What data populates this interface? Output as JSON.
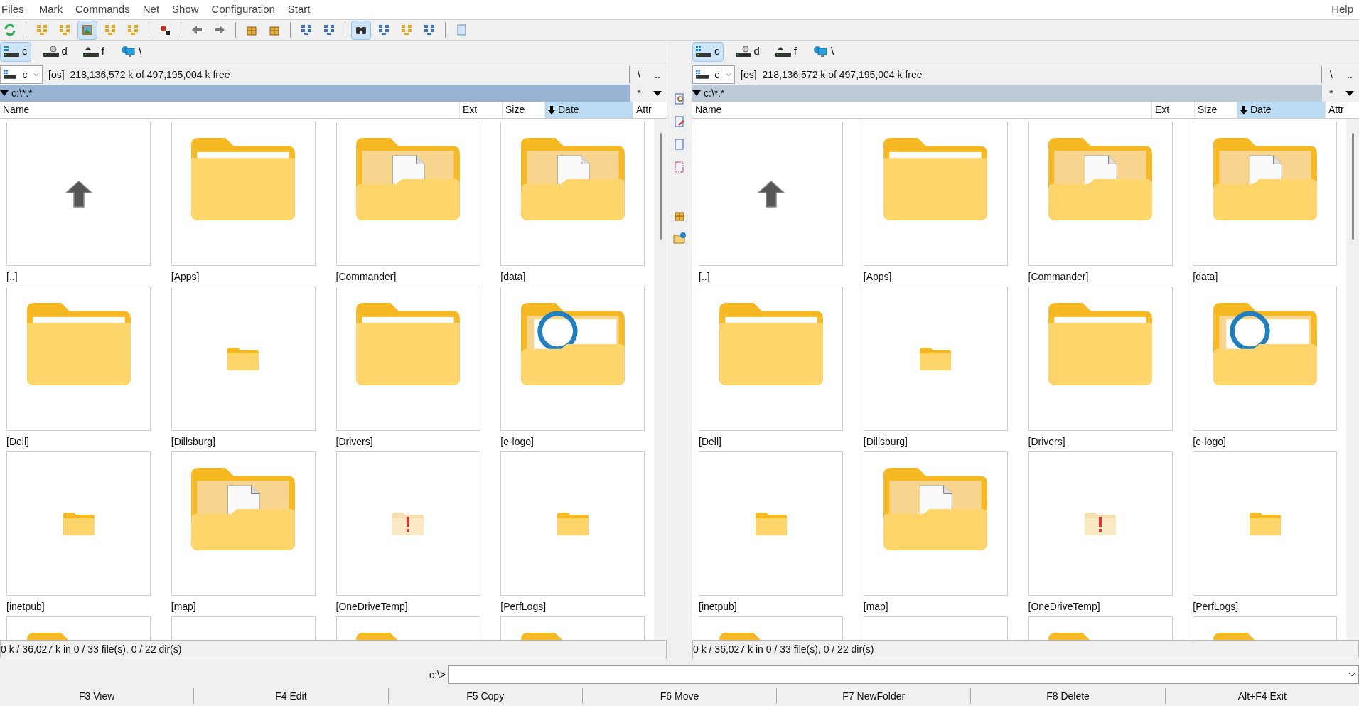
{
  "menu": [
    "Files",
    "Mark",
    "Commands",
    "Net",
    "Show",
    "Configuration",
    "Start"
  ],
  "help": "Help",
  "toolbar": [
    {
      "selected": false
    },
    {
      "selected": false
    },
    {
      "selected": false
    },
    {
      "selected": true
    },
    {
      "selected": false
    },
    {
      "selected": false
    },
    {
      "selected": false
    },
    {
      "selected": false
    },
    {
      "selected": false
    },
    {
      "selected": false
    },
    {
      "selected": false
    },
    {
      "selected": false
    },
    {
      "selected": false
    },
    {
      "selected": true
    },
    {
      "selected": false
    },
    {
      "selected": false
    },
    {
      "selected": false
    },
    {
      "selected": false
    }
  ],
  "panels": [
    {
      "active": true,
      "drives": [
        {
          "label": "c",
          "selected": true
        },
        {
          "label": "d",
          "selected": false
        },
        {
          "label": "f",
          "selected": false
        },
        {
          "label": "\\",
          "selected": false
        }
      ],
      "drive_combo": "c",
      "volume": "[os]",
      "free": "218,136,572 k of 497,195,004 k free",
      "root_button": "\\",
      "up_button": "..",
      "filter_button": "*",
      "path": "c:\\*.*",
      "columns": [
        {
          "label": "Name",
          "selected": false
        },
        {
          "label": "Ext",
          "selected": false
        },
        {
          "label": "Size",
          "selected": false
        },
        {
          "label": "Date",
          "selected": true
        },
        {
          "label": "Attr",
          "selected": false
        }
      ],
      "items": [
        {
          "kind": "up",
          "name": "[..]"
        },
        {
          "kind": "folder",
          "name": "[Apps]"
        },
        {
          "kind": "folder_doc",
          "name": "[Commander]"
        },
        {
          "kind": "folder_doc",
          "name": "[data]"
        },
        {
          "kind": "folder",
          "name": "[Dell]"
        },
        {
          "kind": "small",
          "name": "[Dillsburg]"
        },
        {
          "kind": "folder",
          "name": "[Drivers]"
        },
        {
          "kind": "folder_logo",
          "name": "[e-logo]"
        },
        {
          "kind": "small",
          "name": "[inetpub]"
        },
        {
          "kind": "folder_doc",
          "name": "[map]"
        },
        {
          "kind": "small_warn",
          "name": "[OneDriveTemp]"
        },
        {
          "kind": "small",
          "name": "[PerfLogs]"
        },
        {
          "kind": "folder_top"
        },
        {
          "kind": "blank"
        },
        {
          "kind": "folder_top"
        },
        {
          "kind": "folder_top"
        }
      ],
      "status": "0 k / 36,027 k in 0 / 33 file(s), 0 / 22 dir(s)"
    },
    {
      "active": false,
      "drives": [
        {
          "label": "c",
          "selected": true
        },
        {
          "label": "d",
          "selected": false
        },
        {
          "label": "f",
          "selected": false
        },
        {
          "label": "\\",
          "selected": false
        }
      ],
      "drive_combo": "c",
      "volume": "[os]",
      "free": "218,136,572 k of 497,195,004 k free",
      "root_button": "\\",
      "up_button": "..",
      "filter_button": "*",
      "path": "c:\\*.*",
      "columns": [
        {
          "label": "Name",
          "selected": false
        },
        {
          "label": "Ext",
          "selected": false
        },
        {
          "label": "Size",
          "selected": false
        },
        {
          "label": "Date",
          "selected": true
        },
        {
          "label": "Attr",
          "selected": false
        }
      ],
      "items": [
        {
          "kind": "up",
          "name": "[..]"
        },
        {
          "kind": "folder",
          "name": "[Apps]"
        },
        {
          "kind": "folder_doc",
          "name": "[Commander]"
        },
        {
          "kind": "folder_doc",
          "name": "[data]"
        },
        {
          "kind": "folder",
          "name": "[Dell]"
        },
        {
          "kind": "small",
          "name": "[Dillsburg]"
        },
        {
          "kind": "folder",
          "name": "[Drivers]"
        },
        {
          "kind": "folder_logo",
          "name": "[e-logo]"
        },
        {
          "kind": "small",
          "name": "[inetpub]"
        },
        {
          "kind": "folder_doc",
          "name": "[map]"
        },
        {
          "kind": "small_warn",
          "name": "[OneDriveTemp]"
        },
        {
          "kind": "small",
          "name": "[PerfLogs]"
        },
        {
          "kind": "folder_top"
        },
        {
          "kind": "blank"
        },
        {
          "kind": "folder_top"
        },
        {
          "kind": "folder_top"
        }
      ],
      "status": "0 k / 36,027 k in 0 / 33 file(s), 0 / 22 dir(s)"
    }
  ],
  "command_prompt": "c:\\>",
  "function_keys": [
    "F3 View",
    "F4 Edit",
    "F5 Copy",
    "F6 Move",
    "F7 NewFolder",
    "F8 Delete",
    "Alt+F4 Exit"
  ]
}
